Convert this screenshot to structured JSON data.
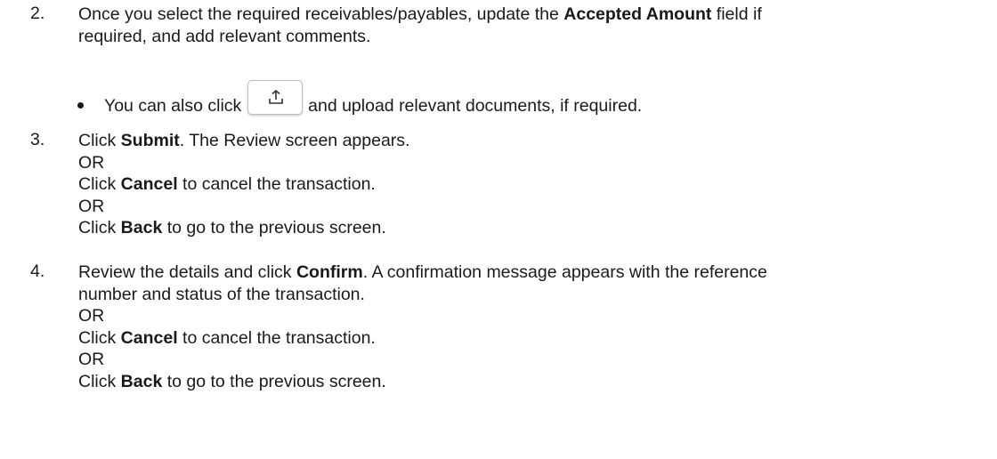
{
  "step2": {
    "number": "2.",
    "line1_a": "Once you select the required receivables/payables, update the ",
    "line1_bold": "Accepted Amount",
    "line1_b": " field if",
    "line2": "required, and add relevant comments.",
    "bullet_a": "You can also click ",
    "upload_icon": "upload-icon",
    "bullet_b": " and upload relevant documents, if required."
  },
  "step3": {
    "number": "3.",
    "l1_a": "Click ",
    "l1_bold": "Submit",
    "l1_b": ". The Review screen appears.",
    "or1": "OR",
    "l2_a": "Click ",
    "l2_bold": "Cancel",
    "l2_b": " to cancel the transaction.",
    "or2": "OR",
    "l3_a": "Click ",
    "l3_bold": "Back",
    "l3_b": " to go to the previous screen."
  },
  "step4": {
    "number": "4.",
    "l1_a": "Review the details and click ",
    "l1_bold": "Confirm",
    "l1_b": ". A confirmation message appears with the reference",
    "l2": "number and status of the transaction.",
    "or1": "OR",
    "l3_a": "Click ",
    "l3_bold": "Cancel",
    "l3_b": " to cancel the transaction.",
    "or2": "OR",
    "l4_a": "Click ",
    "l4_bold": "Back",
    "l4_b": " to go to the previous screen."
  }
}
